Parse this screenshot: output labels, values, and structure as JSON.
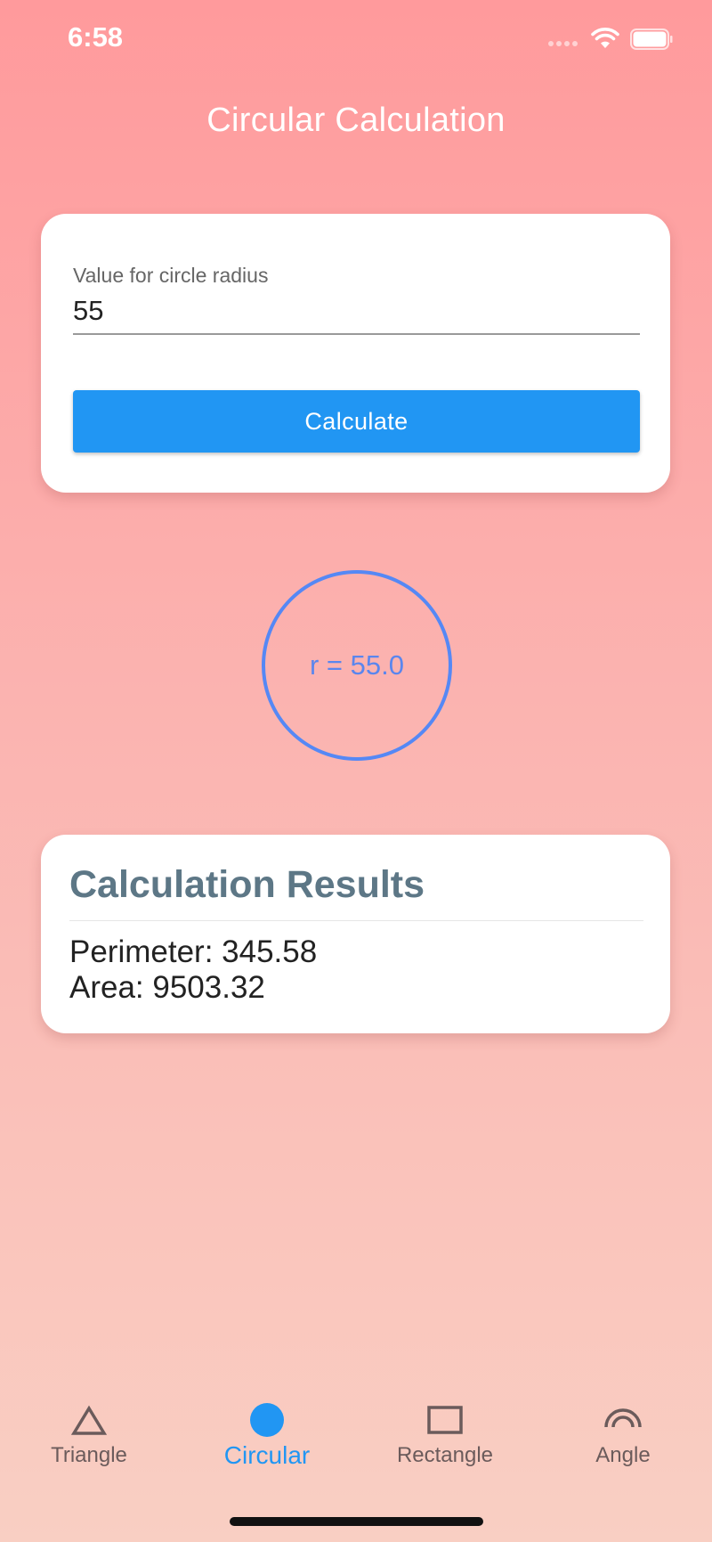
{
  "status_bar": {
    "time": "6:58"
  },
  "header": {
    "title": "Circular Calculation"
  },
  "input_card": {
    "label": "Value for circle radius",
    "value": "55",
    "button_label": "Calculate"
  },
  "circle_visual": {
    "label": "r = 55.0",
    "stroke_color": "#5588f5"
  },
  "results": {
    "title": "Calculation Results",
    "perimeter": "Perimeter: 345.58",
    "area": "Area: 9503.32"
  },
  "bottom_nav": {
    "items": [
      {
        "label": "Triangle",
        "icon": "triangle-icon",
        "active": false
      },
      {
        "label": "Circular",
        "icon": "circle-icon",
        "active": true
      },
      {
        "label": "Rectangle",
        "icon": "rectangle-icon",
        "active": false
      },
      {
        "label": "Angle",
        "icon": "angle-icon",
        "active": false
      }
    ]
  },
  "colors": {
    "accent": "#2196f3",
    "background_top": "#ff9a9c",
    "background_bottom": "#f9cfc3",
    "results_title": "#5d7786"
  }
}
